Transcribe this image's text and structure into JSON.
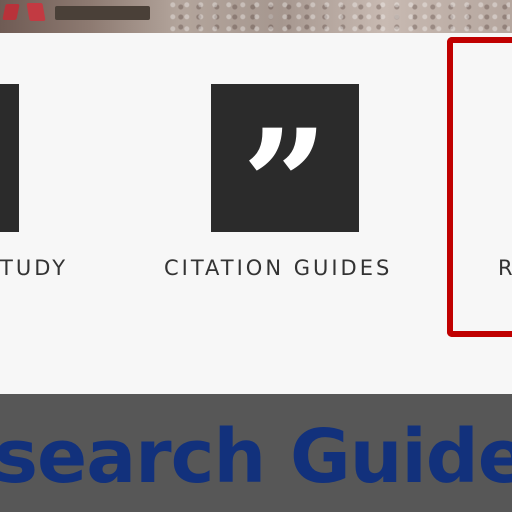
{
  "cards": [
    {
      "label": "TUDY",
      "icon": "book-icon"
    },
    {
      "label": "CITATION GUIDES",
      "icon": "quote-icon",
      "glyph": "”"
    },
    {
      "label": "R",
      "icon": "research-icon"
    }
  ],
  "banner": {
    "title": "search Guide"
  },
  "colors": {
    "highlight": "#c00000",
    "banner_bg": "#575757",
    "banner_text": "#12317c",
    "icon_bg": "#2b2b2b"
  }
}
